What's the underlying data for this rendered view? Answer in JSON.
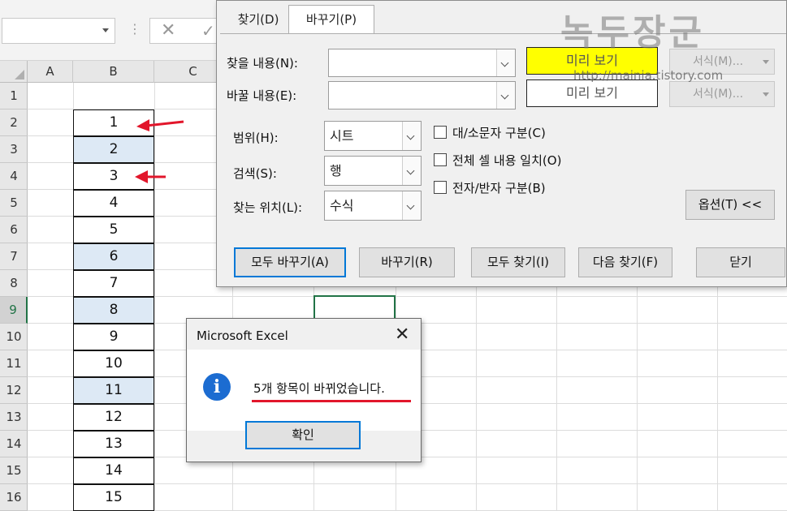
{
  "spreadsheet": {
    "columns": [
      "A",
      "B",
      "C"
    ],
    "rows": [
      "1",
      "2",
      "3",
      "4",
      "5",
      "6",
      "7",
      "8",
      "9",
      "10",
      "11",
      "12",
      "13",
      "14",
      "15",
      "16"
    ],
    "selected_row": "9",
    "b_values": [
      "1",
      "2",
      "3",
      "4",
      "5",
      "6",
      "7",
      "8",
      "9",
      "10",
      "11",
      "12",
      "13",
      "14",
      "15"
    ],
    "highlighted_values": [
      "2",
      "6",
      "8",
      "11"
    ]
  },
  "find_replace": {
    "tabs": {
      "find": "찾기(D)",
      "replace": "바꾸기(P)"
    },
    "find_label": "찾을 내용(N):",
    "replace_label": "바꿀 내용(E):",
    "find_value": "",
    "replace_value": "",
    "preview_find": "미리 보기",
    "preview_replace": "미리 보기",
    "format_button": "서식(M)...",
    "format_button2": "서식(M)...",
    "scope_label": "범위(H):",
    "scope_value": "시트",
    "search_label": "검색(S):",
    "search_value": "행",
    "lookin_label": "찾는 위치(L):",
    "lookin_value": "수식",
    "match_case": "대/소문자 구분(C)",
    "match_entire": "전체 셀 내용 일치(O)",
    "match_byte": "전자/반자 구분(B)",
    "options_button": "옵션(T) <<",
    "replace_all": "모두 바꾸기(A)",
    "replace": "바꾸기(R)",
    "find_all": "모두 찾기(I)",
    "find_next": "다음 찾기(F)",
    "close": "닫기",
    "preview_highlight_color": "#ffff00"
  },
  "watermark": {
    "title": "녹두장군",
    "url": "http://mainia.tistory.com"
  },
  "message_box": {
    "title": "Microsoft Excel",
    "message": "5개 항목이 바뀌었습니다.",
    "ok": "확인",
    "info_glyph": "i"
  },
  "colors": {
    "accent_green": "#217346",
    "highlight_blue": "#dde9f5",
    "arrow_red": "#e2162b"
  }
}
